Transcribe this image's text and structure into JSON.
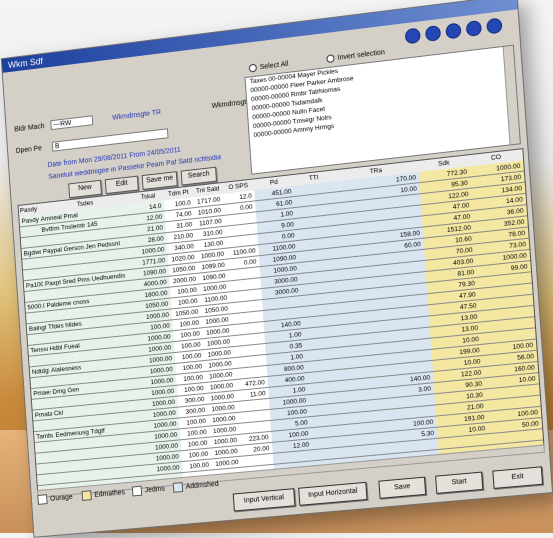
{
  "window": {
    "title": "Wkm Sdf"
  },
  "form": {
    "field1_label": "Bldr Mach",
    "field1_value": "---RW",
    "field2_label": "Dpen Pe",
    "field2_value": "B",
    "blue_note": "Wkmdmsgte TR",
    "date_line": "Date from Mon  29/08/2011   From   24/05/2011",
    "sort_line": "Saneluit weddmigee in Passelor Peam Paf Satd ncfitsidia",
    "employee_label": "Wkmdmsgte P",
    "radio_select_all": "Select All",
    "radio_invert": "Invert selection"
  },
  "buttons": {
    "new": "New",
    "edit": "Edit",
    "save_filter": "Save me",
    "search": "Search"
  },
  "employees": [
    "Taxes 00-00004 Mayer Pickles",
    "00000-00000 Fleer Parker Ambrose",
    "00000-00000 Rmbr Tatrhiomas",
    "00000-00000 Tsdamdalk",
    "00000-00000 Nulln Facet",
    "00000-00000 Tmsegr Nolrs",
    "00000-00000 Amnny Hrmgs"
  ],
  "grid": {
    "headers": [
      "Pasdy",
      "Tsdes",
      "Tskal",
      "Tdm Pt",
      "Tnl Sald",
      "O SPS",
      "Pd",
      "TTl",
      "TRa",
      "Sdk",
      "CO"
    ],
    "rows": [
      [
        "Pasdy",
        "Amneal Pmal",
        "14.0",
        "100.0",
        "1717.00",
        "12.0",
        "451.00",
        "",
        "170.00",
        "772.30",
        "1000.00"
      ],
      [
        "",
        "Bvtfrm Tnslemtr 145",
        "12.00",
        "74.00",
        "1010.00",
        "0.00",
        "61.00",
        "",
        "10.00",
        "95.30",
        "173.00"
      ],
      [
        "",
        "",
        "21.00",
        "31.00",
        "1107.00",
        "",
        "1.00",
        "",
        "",
        "122.00",
        "134.00"
      ],
      [
        "Bgdweeek",
        "Paypal Gerscn Jen Pedssnt",
        "28.00",
        "210.00",
        "310.00",
        "",
        "9.00",
        "",
        "",
        "47.00",
        "14.00"
      ],
      [
        "",
        "",
        "1000.00",
        "340.00",
        "130.00",
        "",
        "0.00",
        "",
        "",
        "47.00",
        "36.00"
      ],
      [
        "",
        "",
        "1771.00",
        "1020.00",
        "1000.00",
        "1100.00",
        "1100.00",
        "",
        "158.00",
        "1512.00",
        "352.00"
      ],
      [
        "Pa1000000",
        "Paxpl Sred Pms Uedhuendis",
        "1090.00",
        "1050.00",
        "1099.00",
        "0.00",
        "1090.00",
        "",
        "60.00",
        "10.60",
        "78.00"
      ],
      [
        "",
        "",
        "4000.00",
        "2000.00",
        "1090.00",
        "",
        "1000.00",
        "",
        "",
        "70.00",
        "73.00"
      ],
      [
        "5000.00",
        "Paldeme cnoss",
        "1800.00",
        "100.00",
        "1000.00",
        "",
        "3000.00",
        "",
        "",
        "403.00",
        "1000.00"
      ],
      [
        "",
        "",
        "1050.00",
        "100.00",
        "1100.00",
        "",
        "3000.00",
        "",
        "",
        "81.00",
        "99.00"
      ],
      [
        "Balngta",
        "Tfdes hlldes",
        "1000.00",
        "1050.00",
        "1050.00",
        "",
        "",
        "",
        "",
        "79.30",
        ""
      ],
      [
        "",
        "",
        "100.00",
        "100.00",
        "1000.00",
        "",
        "",
        "",
        "",
        "47.90",
        ""
      ],
      [
        "Tenssnth",
        "Hdbl Fueal",
        "1000.00",
        "100.00",
        "1000.00",
        "",
        "140.00",
        "",
        "",
        "47.50",
        ""
      ],
      [
        "",
        "",
        "1000.00",
        "100.00",
        "1000.00",
        "",
        "1.00",
        "",
        "",
        "13.00",
        ""
      ],
      [
        "Ndtdglbaa",
        "Alalesness",
        "1000.00",
        "100.00",
        "1000.00",
        "",
        "0.35",
        "",
        "",
        "13.00",
        ""
      ],
      [
        "",
        "",
        "1000.00",
        "100.00",
        "1000.00",
        "",
        "1.00",
        "",
        "",
        "10.00",
        ""
      ],
      [
        "Pmaesl",
        "Dmg Gen",
        "1000.00",
        "100.00",
        "1000.00",
        "",
        "800.00",
        "",
        "",
        "199.00",
        "100.00"
      ],
      [
        "",
        "",
        "1000.00",
        "100.00",
        "1000.00",
        "472.00",
        "400.00",
        "",
        "",
        "10.00",
        "56.00"
      ],
      [
        "Pmatatik",
        "Ckl",
        "1000.00",
        "300.00",
        "1000.00",
        "11.00",
        "1.00",
        "",
        "140.00",
        "122.00",
        "160.00"
      ],
      [
        "",
        "",
        "1000.00",
        "300.00",
        "1000.00",
        "",
        "1000.00",
        "",
        "3.00",
        "90.30",
        "10.00"
      ],
      [
        "Tambudh",
        "Eedmenusg Tdgtf",
        "1000.00",
        "100.00",
        "1000.00",
        "",
        "100.00",
        "",
        "",
        "10.30",
        ""
      ],
      [
        "",
        "",
        "1000.00",
        "100.00",
        "1000.00",
        "",
        "5.00",
        "",
        "",
        "21.00",
        ""
      ],
      [
        "",
        "",
        "1000.00",
        "100.00",
        "1000.00",
        "223.00",
        "100.00",
        "",
        "100.00",
        "191.00",
        "100.00"
      ],
      [
        "",
        "",
        "1000.00",
        "100.00",
        "1000.00",
        "20.00",
        "12.00",
        "",
        "5.30",
        "10.00",
        "50.00"
      ],
      [
        "",
        "",
        "1000.00",
        "100.00",
        "1000.00",
        "",
        "",
        "",
        "",
        "",
        ""
      ]
    ]
  },
  "legend": [
    {
      "label": "Ourage",
      "color": "#ffffff"
    },
    {
      "label": "Edmathes",
      "color": "#f3e7a2"
    },
    {
      "label": "Jedms",
      "color": "#ffffff"
    },
    {
      "label": "Addmshed",
      "color": "#d9e6f2"
    }
  ],
  "actions": {
    "input_vertical": "Input Vertical",
    "input_horizontal": "Input Horizontal",
    "save": "Save",
    "start": "Start",
    "exit": "Exit"
  },
  "colors": {
    "title_bar": "#1c3f9e",
    "green_panel": "#e6f2ea",
    "blue_panel": "#d9e6f2",
    "yellow_panel": "#f3e7a2"
  }
}
